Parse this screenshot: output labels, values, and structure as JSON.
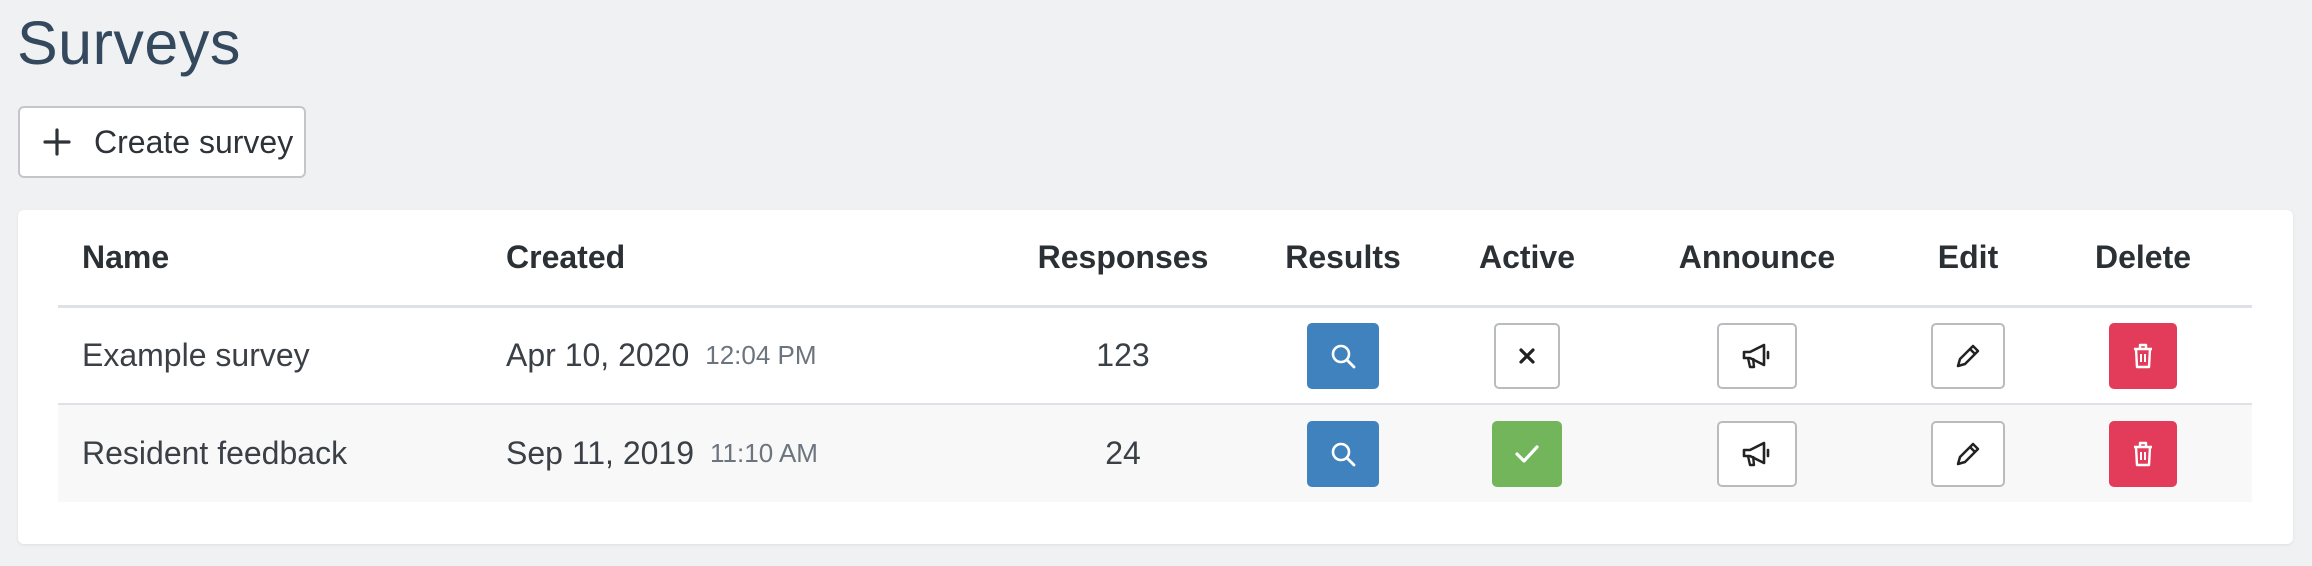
{
  "page": {
    "title": "Surveys"
  },
  "toolbar": {
    "create_label": "Create survey"
  },
  "table": {
    "headers": {
      "name": "Name",
      "created": "Created",
      "responses": "Responses",
      "results": "Results",
      "active": "Active",
      "announce": "Announce",
      "edit": "Edit",
      "delete": "Delete"
    },
    "rows": [
      {
        "name": "Example survey",
        "created_date": "Apr 10, 2020",
        "created_time": "12:04 PM",
        "responses": "123",
        "active": false
      },
      {
        "name": "Resident feedback",
        "created_date": "Sep 11, 2019",
        "created_time": "11:10 AM",
        "responses": "24",
        "active": true
      }
    ]
  },
  "icons": {
    "create": "plus-icon",
    "results": "search-icon",
    "inactive": "close-icon",
    "active": "check-icon",
    "announce": "megaphone-icon",
    "edit": "pencil-icon",
    "delete": "trash-icon"
  },
  "colors": {
    "results_button": "#3f82bd",
    "active_button": "#73b55a",
    "delete_button": "#e23c5a",
    "title": "#34495e"
  }
}
